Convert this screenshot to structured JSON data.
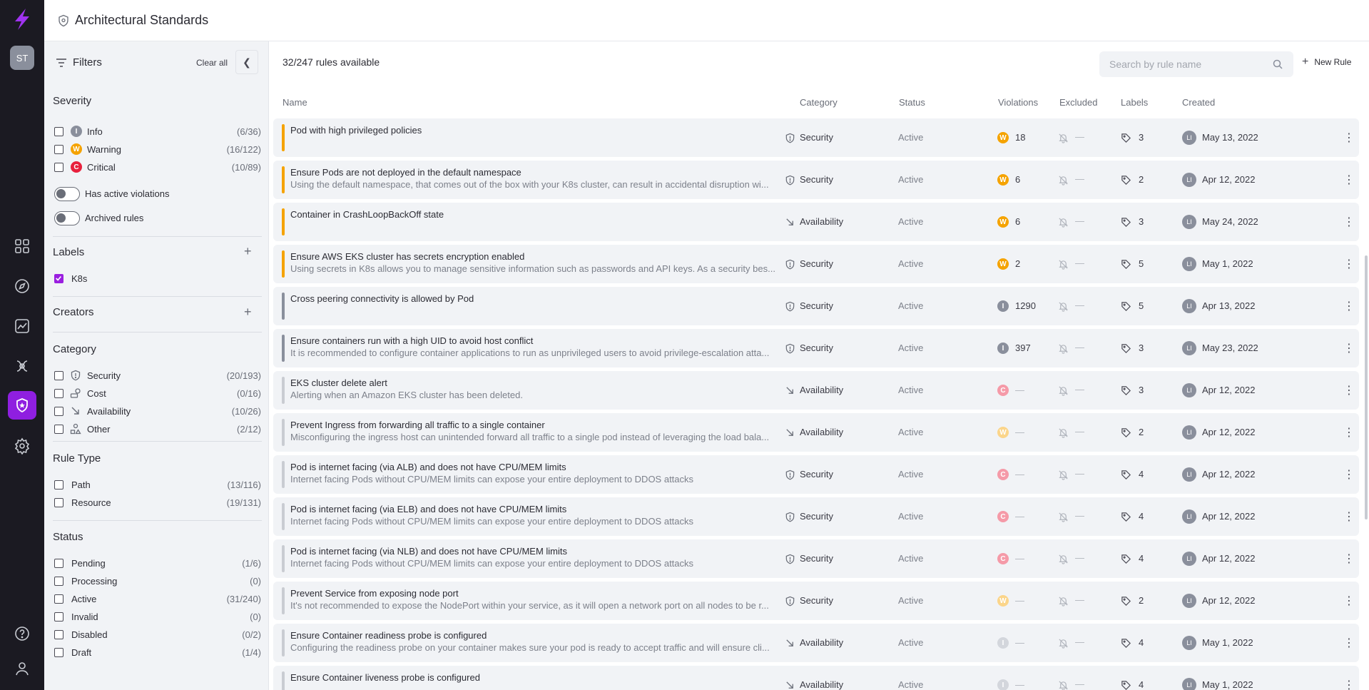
{
  "app": {
    "title": "Architectural Standards",
    "avatar": "ST"
  },
  "filters": {
    "title": "Filters",
    "clear_label": "Clear all",
    "severity": {
      "title": "Severity",
      "items": [
        {
          "label": "Info",
          "count": "(6/36)",
          "letter": "I",
          "color": "#8a8f9c"
        },
        {
          "label": "Warning",
          "count": "(16/122)",
          "letter": "W",
          "color": "#f5a300"
        },
        {
          "label": "Critical",
          "count": "(10/89)",
          "letter": "C",
          "color": "#e8213d"
        }
      ]
    },
    "toggles": [
      {
        "label": "Has active violations"
      },
      {
        "label": "Archived rules"
      }
    ],
    "labels": {
      "title": "Labels",
      "items": [
        {
          "label": "K8s",
          "checked": true
        }
      ]
    },
    "creators": {
      "title": "Creators"
    },
    "category": {
      "title": "Category",
      "items": [
        {
          "label": "Security",
          "count": "(20/193)",
          "icon": "shield-icon"
        },
        {
          "label": "Cost",
          "count": "(0/16)",
          "icon": "cost-icon"
        },
        {
          "label": "Availability",
          "count": "(10/26)",
          "icon": "arrow-down-right-icon"
        },
        {
          "label": "Other",
          "count": "(2/12)",
          "icon": "other-icon"
        }
      ]
    },
    "rule_type": {
      "title": "Rule Type",
      "items": [
        {
          "label": "Path",
          "count": "(13/116)"
        },
        {
          "label": "Resource",
          "count": "(19/131)"
        }
      ]
    },
    "status": {
      "title": "Status",
      "items": [
        {
          "label": "Pending",
          "count": "(1/6)"
        },
        {
          "label": "Processing",
          "count": "(0)"
        },
        {
          "label": "Active",
          "count": "(31/240)"
        },
        {
          "label": "Invalid",
          "count": "(0)"
        },
        {
          "label": "Disabled",
          "count": "(0/2)"
        },
        {
          "label": "Draft",
          "count": "(1/4)"
        }
      ]
    }
  },
  "main": {
    "count_label": "32/247 rules available",
    "search_placeholder": "Search by rule name",
    "new_rule_label": "New Rule",
    "columns": [
      "Name",
      "Category",
      "Status",
      "Violations",
      "Excluded",
      "Labels",
      "Created"
    ],
    "rows": [
      {
        "name": "Pod with high privileged policies",
        "desc": "",
        "category": "Security",
        "status": "Active",
        "sev": "W",
        "violations": "18",
        "labels": "3",
        "creator": "LI",
        "created": "May 13, 2022",
        "bar": "#f5a300"
      },
      {
        "name": "Ensure Pods are not deployed in the default namespace",
        "desc": "Using the default namespace, that comes out of the box with your K8s cluster, can result in accidental disruption wi...",
        "category": "Security",
        "status": "Active",
        "sev": "W",
        "violations": "6",
        "labels": "2",
        "creator": "LI",
        "created": "Apr 12, 2022",
        "bar": "#f5a300"
      },
      {
        "name": "Container in CrashLoopBackOff state",
        "desc": "",
        "category": "Availability",
        "status": "Active",
        "sev": "W",
        "violations": "6",
        "labels": "3",
        "creator": "LI",
        "created": "May 24, 2022",
        "bar": "#f5a300"
      },
      {
        "name": "Ensure AWS EKS cluster has secrets encryption enabled",
        "desc": "Using secrets in K8s allows you to manage sensitive information such as passwords and API keys. As a security bes...",
        "category": "Security",
        "status": "Active",
        "sev": "W",
        "violations": "2",
        "labels": "5",
        "creator": "LI",
        "created": "May 1, 2022",
        "bar": "#f5a300"
      },
      {
        "name": "Cross peering connectivity is allowed by Pod",
        "desc": "",
        "category": "Security",
        "status": "Active",
        "sev": "I",
        "violations": "1290",
        "labels": "5",
        "creator": "LI",
        "created": "Apr 13, 2022",
        "bar": "#8a8f9c"
      },
      {
        "name": "Ensure containers run with a high UID to avoid host conflict",
        "desc": "It is recommended to configure container applications to run as unprivileged users to avoid privilege-escalation atta...",
        "category": "Security",
        "status": "Active",
        "sev": "I",
        "violations": "397",
        "labels": "3",
        "creator": "LI",
        "created": "May 23, 2022",
        "bar": "#8a8f9c"
      },
      {
        "name": "EKS cluster delete alert",
        "desc": "Alerting when an Amazon EKS cluster has been deleted.",
        "category": "Availability",
        "status": "Active",
        "sev": "Cf",
        "violations": "—",
        "labels": "3",
        "creator": "LI",
        "created": "Apr 12, 2022",
        "bar": "#c9ccd2"
      },
      {
        "name": "Prevent Ingress from forwarding all traffic to a single container",
        "desc": "Misconfiguring the ingress host can unintended forward all traffic to a single pod instead of leveraging the load bala...",
        "category": "Availability",
        "status": "Active",
        "sev": "Wf",
        "violations": "—",
        "labels": "2",
        "creator": "LI",
        "created": "Apr 12, 2022",
        "bar": "#c9ccd2"
      },
      {
        "name": "Pod is internet facing (via ALB) and does not have CPU/MEM limits",
        "desc": "Internet facing Pods without CPU/MEM limits can expose your entire deployment to DDOS attacks",
        "category": "Security",
        "status": "Active",
        "sev": "Cf",
        "violations": "—",
        "labels": "4",
        "creator": "LI",
        "created": "Apr 12, 2022",
        "bar": "#c9ccd2"
      },
      {
        "name": "Pod is internet facing (via ELB) and does not have CPU/MEM limits",
        "desc": "Internet facing Pods without CPU/MEM limits can expose your entire deployment to DDOS attacks",
        "category": "Security",
        "status": "Active",
        "sev": "Cf",
        "violations": "—",
        "labels": "4",
        "creator": "LI",
        "created": "Apr 12, 2022",
        "bar": "#c9ccd2"
      },
      {
        "name": "Pod is internet facing (via NLB) and does not have CPU/MEM limits",
        "desc": "Internet facing Pods without CPU/MEM limits can expose your entire deployment to DDOS attacks",
        "category": "Security",
        "status": "Active",
        "sev": "Cf",
        "violations": "—",
        "labels": "4",
        "creator": "LI",
        "created": "Apr 12, 2022",
        "bar": "#c9ccd2"
      },
      {
        "name": "Prevent Service from exposing node port",
        "desc": "It's not recommended to expose the NodePort within your service, as it will open a network port on all nodes to be r...",
        "category": "Security",
        "status": "Active",
        "sev": "Wf",
        "violations": "—",
        "labels": "2",
        "creator": "LI",
        "created": "Apr 12, 2022",
        "bar": "#c9ccd2"
      },
      {
        "name": "Ensure Container readiness probe is configured",
        "desc": "Configuring the readiness probe on your container makes sure your pod is ready to accept traffic and will ensure cli...",
        "category": "Availability",
        "status": "Active",
        "sev": "If",
        "violations": "—",
        "labels": "4",
        "creator": "LI",
        "created": "May 1, 2022",
        "bar": "#c9ccd2"
      },
      {
        "name": "Ensure Container liveness probe is configured",
        "desc": "",
        "category": "Availability",
        "status": "Active",
        "sev": "If",
        "violations": "—",
        "labels": "4",
        "creator": "LI",
        "created": "May 1, 2022",
        "bar": "#c9ccd2"
      }
    ]
  },
  "colors": {
    "accent": "#8f1fe0",
    "warning": "#f5a300",
    "critical": "#e8213d",
    "info": "#8a8f9c"
  }
}
